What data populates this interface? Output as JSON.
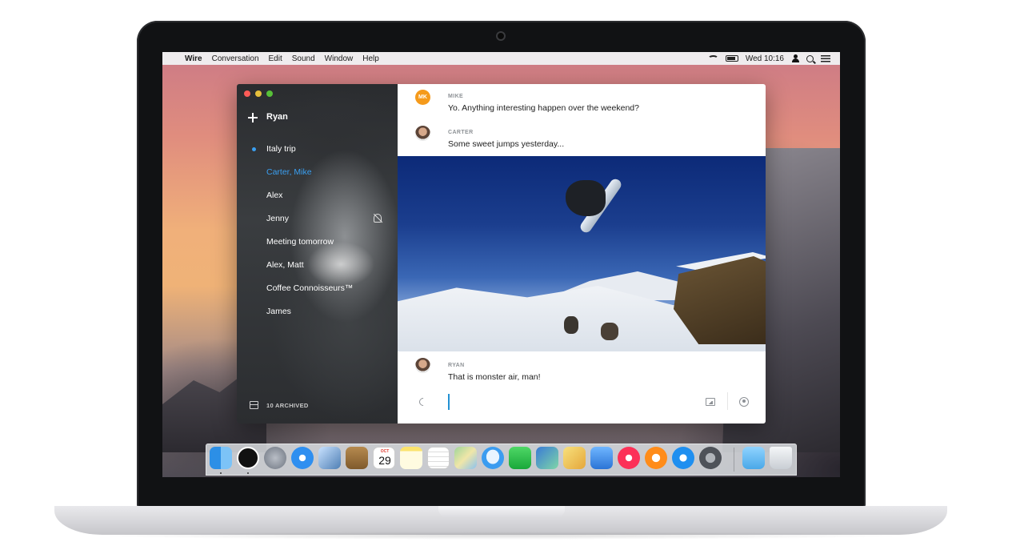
{
  "menubar": {
    "app_name": "Wire",
    "menus": [
      "Conversation",
      "Edit",
      "Sound",
      "Window",
      "Help"
    ],
    "clock": "Wed 10:16"
  },
  "sidebar": {
    "user_name": "Ryan",
    "conversations": [
      {
        "name": "Italy trip",
        "unread": true
      },
      {
        "name": "Carter, Mike",
        "active": true
      },
      {
        "name": "Alex"
      },
      {
        "name": "Jenny",
        "muted": true
      },
      {
        "name": "Meeting tomorrow"
      },
      {
        "name": "Alex, Matt"
      },
      {
        "name": "Coffee Connoisseurs™"
      },
      {
        "name": "James"
      }
    ],
    "archived_label": "10 ARCHIVED"
  },
  "conversation": {
    "messages": [
      {
        "sender": "MIKE",
        "avatar_initials": "MK",
        "avatar_color": "#f59a1b",
        "text": "Yo. Anything interesting happen over the weekend?"
      },
      {
        "sender": "CARTER",
        "text": "Some sweet jumps yesterday..."
      },
      {
        "sender": "RYAN",
        "text": "That is monster air, man!"
      }
    ],
    "composer_value": ""
  },
  "dock": {
    "calendar_month": "OCT",
    "calendar_day": "29",
    "apps": [
      "finder-icon",
      "wire-icon",
      "launchpad-icon",
      "safari-icon",
      "preview-icon",
      "contacts-icon",
      "calendar-icon",
      "notes-icon",
      "reminders-icon",
      "maps-icon",
      "messages-icon",
      "facetime-icon",
      "photos-icon",
      "pages-icon",
      "keynote-icon",
      "itunes-icon",
      "ibooks-icon",
      "app-store-icon",
      "system-preferences-icon",
      "downloads-icon",
      "trash-icon"
    ]
  },
  "colors": {
    "accent": "#3a9ff0",
    "wire_mike": "#f59a1b"
  }
}
